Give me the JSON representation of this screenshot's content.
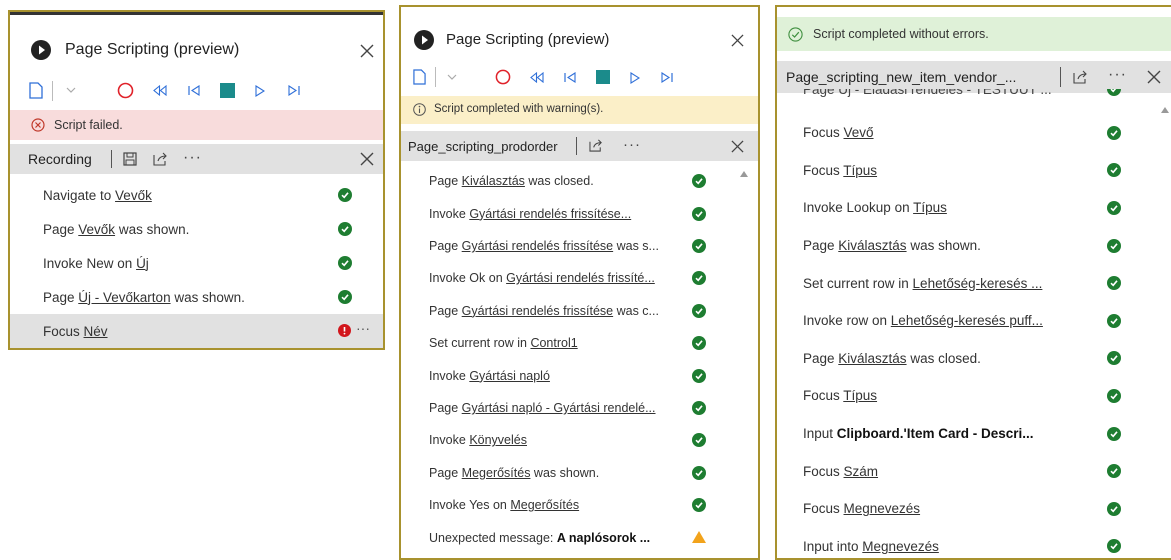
{
  "panel1": {
    "title": "Page Scripting (preview)",
    "status": "Script failed.",
    "section_label": "Recording",
    "more": "···",
    "steps": [
      {
        "pre": "Navigate to ",
        "link": "Vevők",
        "post": "",
        "status": "ok"
      },
      {
        "pre": "Page ",
        "link": "Vevők",
        "post": " was shown.",
        "status": "ok"
      },
      {
        "pre": "Invoke New on ",
        "link": "Új",
        "post": "",
        "status": "ok"
      },
      {
        "pre": "Page ",
        "link": "Új - Vevőkarton",
        "post": " was shown.",
        "status": "ok"
      },
      {
        "pre": "Focus ",
        "link": "Név",
        "post": "",
        "status": "error"
      }
    ]
  },
  "panel2": {
    "title": "Page Scripting (preview)",
    "status": "Script completed with warning(s).",
    "script_name": "Page_scripting_prodorder",
    "more": "···",
    "steps": [
      {
        "pre": "Page ",
        "link": "Kiválasztás",
        "post": " was closed.",
        "status": "ok"
      },
      {
        "pre": "Invoke ",
        "link": "Gyártási rendelés frissítése...",
        "post": "",
        "status": "ok"
      },
      {
        "pre": "Page ",
        "link": "Gyártási rendelés frissítése",
        "post": " was s...",
        "status": "ok"
      },
      {
        "pre": "Invoke Ok on ",
        "link": "Gyártási rendelés frissíté...",
        "post": "",
        "status": "ok"
      },
      {
        "pre": "Page ",
        "link": "Gyártási rendelés frissítése",
        "post": " was c...",
        "status": "ok"
      },
      {
        "pre": "Set current row in ",
        "link": "Control1",
        "post": "",
        "status": "ok"
      },
      {
        "pre": "Invoke ",
        "link": "Gyártási napló",
        "post": "",
        "status": "ok"
      },
      {
        "pre": "Page ",
        "link": "Gyártási napló - Gyártási rendelé...",
        "post": "",
        "status": "ok"
      },
      {
        "pre": "Invoke ",
        "link": "Könyvelés",
        "post": "",
        "status": "ok"
      },
      {
        "pre": "Page ",
        "link": "Megerősítés",
        "post": " was shown.",
        "status": "ok"
      },
      {
        "pre": "Invoke Yes on ",
        "link": "Megerősítés",
        "post": "",
        "status": "ok"
      },
      {
        "pre": "Unexpected message: ",
        "bold": "A naplósorok ...",
        "post": "",
        "status": "warn"
      }
    ]
  },
  "panel3": {
    "status": "Script completed without errors.",
    "script_name": "Page_scripting_new_item_vendor_...",
    "more": "···",
    "partial_step": "Page Új - Eladási rendelés - TESTUUT ...",
    "steps": [
      {
        "pre": "Focus ",
        "link": "Vevő",
        "post": "",
        "status": "ok"
      },
      {
        "pre": "Focus ",
        "link": "Típus",
        "post": "",
        "status": "ok"
      },
      {
        "pre": "Invoke Lookup on ",
        "link": "Típus",
        "post": "",
        "status": "ok"
      },
      {
        "pre": "Page ",
        "link": "Kiválasztás",
        "post": " was shown.",
        "status": "ok"
      },
      {
        "pre": "Set current row in ",
        "link": "Lehetőség-keresés ...",
        "post": "",
        "status": "ok"
      },
      {
        "pre": "Invoke row on ",
        "link": "Lehetőség-keresés puff...",
        "post": "",
        "status": "ok"
      },
      {
        "pre": "Page ",
        "link": "Kiválasztás",
        "post": " was closed.",
        "status": "ok"
      },
      {
        "pre": "Focus ",
        "link": "Típus",
        "post": "",
        "status": "ok"
      },
      {
        "pre": "Input ",
        "bold": "Clipboard.'Item Card - Descri...",
        "post": "",
        "status": "ok"
      },
      {
        "pre": "Focus ",
        "link": "Szám",
        "post": "",
        "status": "ok"
      },
      {
        "pre": "Focus ",
        "link": "Megnevezés",
        "post": "",
        "status": "ok"
      },
      {
        "pre": "Input into ",
        "link": "Megnevezés",
        "post": "",
        "status": "ok"
      }
    ]
  },
  "colors": {
    "error_bg": "#f8dcdc",
    "warn_bg": "#fbefc8",
    "success_bg": "#dff1d8",
    "check_green": "#1e7d31",
    "error_red": "#d2161c",
    "record_red": "#e0222a",
    "stop_teal": "#1b8b8b",
    "play_blue": "#2f6fd8",
    "frame_gold": "#a8922e"
  },
  "icons": [
    "logo-icon",
    "new-icon",
    "chevron-down-icon",
    "record-icon",
    "rewind-icon",
    "step-back-icon",
    "stop-icon",
    "play-icon",
    "step-forward-icon",
    "close-icon",
    "error-circle-icon",
    "info-icon",
    "save-icon",
    "share-icon",
    "check-icon",
    "warning-icon",
    "success-circle-icon"
  ]
}
